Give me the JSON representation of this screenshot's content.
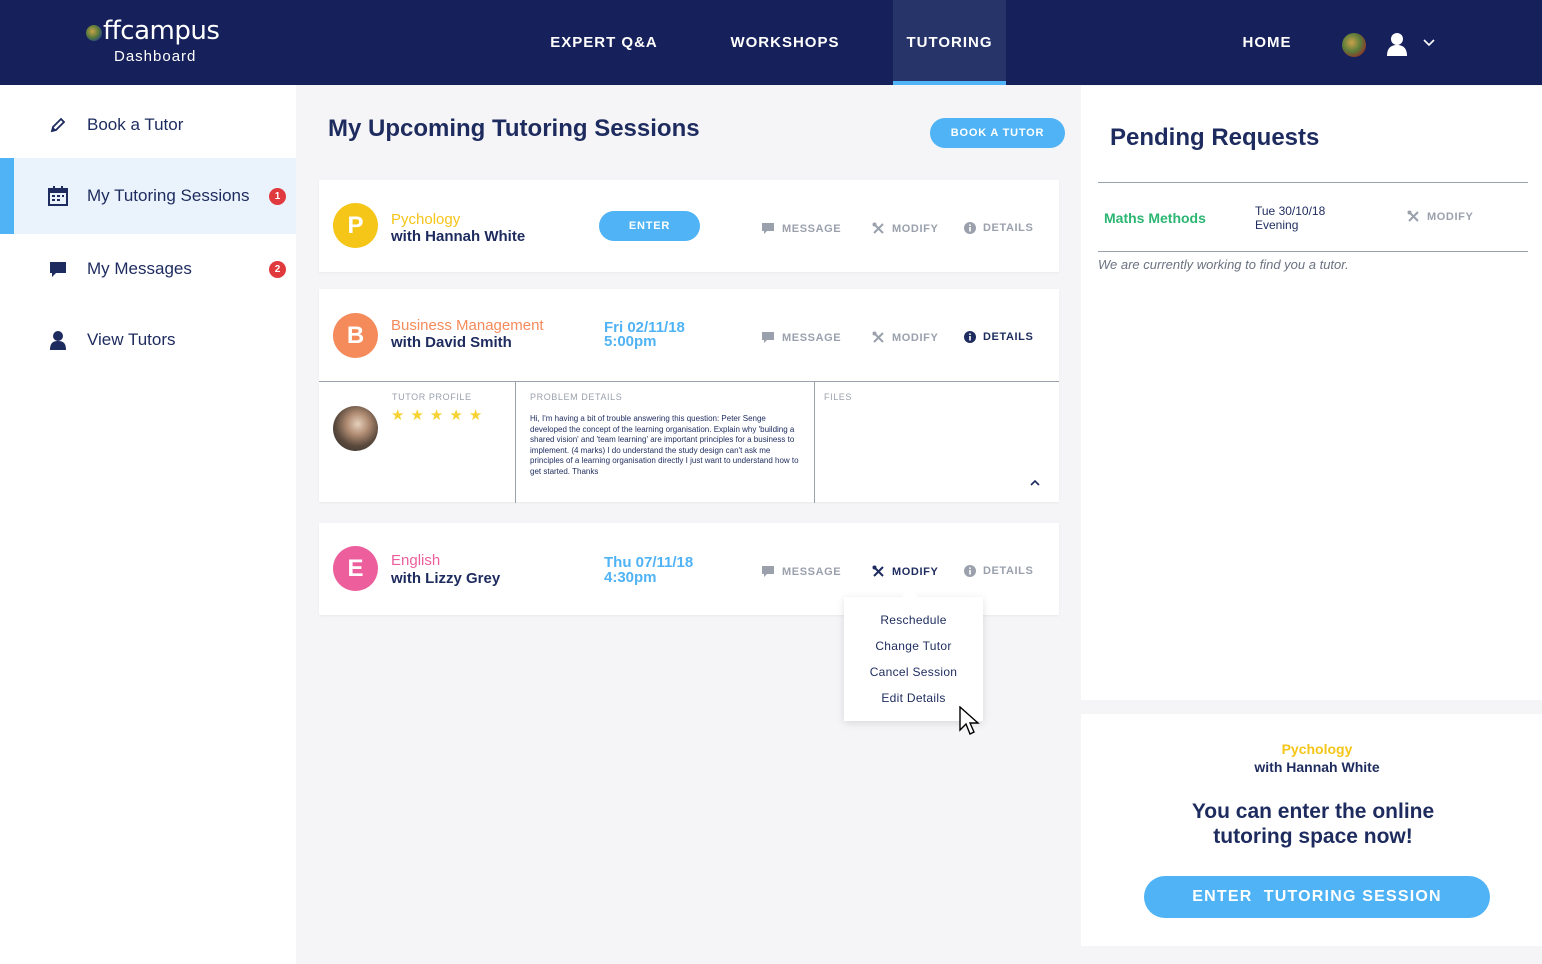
{
  "brand": {
    "logo_text": "ffcampus",
    "logo_sub": "Dashboard"
  },
  "nav": {
    "items": [
      {
        "label": "EXPERT Q&A"
      },
      {
        "label": "WORKSHOPS"
      },
      {
        "label": "TUTORING",
        "active": true
      }
    ],
    "home_label": "HOME"
  },
  "sidebar": {
    "items": [
      {
        "label": "Book a Tutor",
        "icon": "pencil-icon"
      },
      {
        "label": "My Tutoring Sessions",
        "icon": "calendar-icon",
        "badge": "1",
        "active": true
      },
      {
        "label": "My Messages",
        "icon": "chat-icon",
        "badge": "2"
      },
      {
        "label": "View Tutors",
        "icon": "person-icon"
      }
    ]
  },
  "main": {
    "title": "My Upcoming Tutoring Sessions",
    "book_button": "BOOK A TUTOR",
    "actions": {
      "message": "MESSAGE",
      "modify": "MODIFY",
      "details": "DETAILS",
      "enter": "ENTER"
    },
    "sessions": [
      {
        "initial": "P",
        "subject": "Pychology",
        "with": "with Hannah White",
        "color": "#f5c518"
      },
      {
        "initial": "B",
        "subject": "Business Management",
        "with": "with David Smith",
        "date": "Fri 02/11/18",
        "time": "5:00pm",
        "color": "#f58a5a"
      },
      {
        "initial": "E",
        "subject": "English",
        "with": "with Lizzy Grey",
        "date": "Thu 07/11/18",
        "time": "4:30pm",
        "color": "#ec5f9c"
      }
    ],
    "details": {
      "tutor_profile_label": "TUTOR PROFILE",
      "rating": 5,
      "problem_label": "PROBLEM DETAILS",
      "problem_text": "Hi, I'm having a bit of trouble answering this question: Peter Senge developed the concept of the learning organisation. Explain why 'building a shared vision' and 'team learning' are important principles for a business to implement. (4 marks) I do understand the study design can't ask me principles of a learning organisation directly I just want to understand how to get started. Thanks",
      "files_label": "FILES"
    },
    "modify_menu": [
      "Reschedule",
      "Change Tutor",
      "Cancel Session",
      "Edit Details"
    ]
  },
  "pending": {
    "title": "Pending Requests",
    "requests": [
      {
        "subject": "Maths Methods",
        "date": "Tue 30/10/18",
        "time": "Evening",
        "modify": "MODIFY"
      }
    ],
    "note": "We are currently working to find you a tutor."
  },
  "enter_panel": {
    "subject": "Pychology",
    "with": "with Hannah White",
    "message": "You can enter the online tutoring space now!",
    "button": "ENTER  TUTORING SESSION"
  },
  "colors": {
    "navy": "#16205a",
    "accent": "#4fb3f5",
    "badge": "#e0393e",
    "green": "#2bb673"
  }
}
